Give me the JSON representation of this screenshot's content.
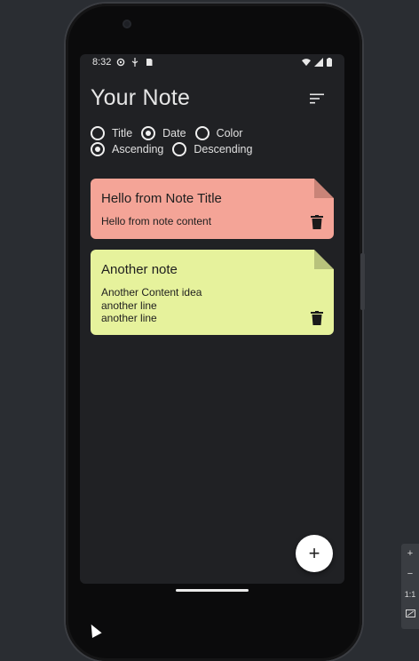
{
  "status_bar": {
    "time": "8:32",
    "icons_left": [
      "settings-icon",
      "usb-icon",
      "sd-card-icon"
    ],
    "icons_right": [
      "wifi-icon",
      "signal-icon",
      "battery-icon"
    ]
  },
  "app": {
    "title": "Your Note",
    "sort_icon": "sort-icon"
  },
  "sort_by": {
    "options": [
      "Title",
      "Date",
      "Color"
    ],
    "selected": "Date"
  },
  "order": {
    "options": [
      "Ascending",
      "Descending"
    ],
    "selected": "Ascending"
  },
  "notes": [
    {
      "title": "Hello from Note Title",
      "content": "Hello from note content",
      "color": "#f4a497",
      "fold_color": "#c98478"
    },
    {
      "title": "Another note",
      "content": "Another Content idea\nanother line\nanother line",
      "color": "#e6f29c",
      "fold_color": "#b8c27c"
    }
  ],
  "fab": {
    "label": "+"
  },
  "emulator_zoom": {
    "plus": "+",
    "minus": "−",
    "one_to_one": "1:1"
  },
  "colors": {
    "background": "#202124",
    "text": "#e6e6e6"
  }
}
